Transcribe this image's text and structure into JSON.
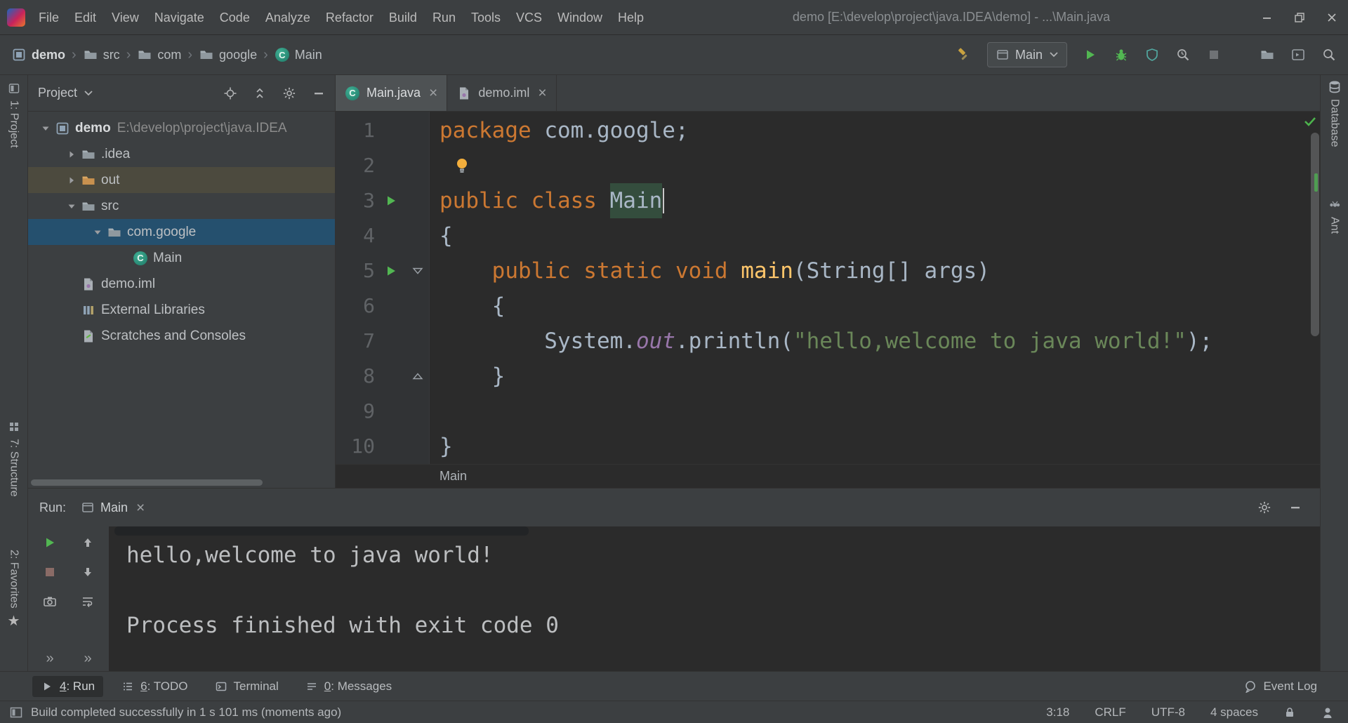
{
  "titlebar": {
    "menus": [
      "File",
      "Edit",
      "View",
      "Navigate",
      "Code",
      "Analyze",
      "Refactor",
      "Build",
      "Run",
      "Tools",
      "VCS",
      "Window",
      "Help"
    ],
    "title": "demo [E:\\develop\\project\\java.IDEA\\demo] - ...\\Main.java"
  },
  "navbar": {
    "breadcrumbs": [
      {
        "label": "demo",
        "icon": "module",
        "bold": true
      },
      {
        "label": "src",
        "icon": "folder"
      },
      {
        "label": "com",
        "icon": "folder"
      },
      {
        "label": "google",
        "icon": "folder"
      },
      {
        "label": "Main",
        "icon": "class"
      }
    ],
    "run_config": "Main"
  },
  "stripes": {
    "left": [
      {
        "label": "1: Project"
      },
      {
        "label": "7: Structure"
      },
      {
        "label": "2: Favorites"
      }
    ],
    "right": [
      {
        "label": "Database"
      },
      {
        "label": "Ant"
      }
    ]
  },
  "project": {
    "header": "Project",
    "tree": [
      {
        "depth": 0,
        "expand": "down",
        "icon": "module",
        "label": "demo",
        "path": "E:\\develop\\project\\java.IDEA",
        "bold": true
      },
      {
        "depth": 1,
        "expand": "right",
        "icon": "folder",
        "label": ".idea"
      },
      {
        "depth": 1,
        "expand": "right",
        "icon": "folder-out",
        "label": "out",
        "highlight": true
      },
      {
        "depth": 1,
        "expand": "down",
        "icon": "folder",
        "label": "src"
      },
      {
        "depth": 2,
        "expand": "down",
        "icon": "folder",
        "label": "com.google",
        "selected": true
      },
      {
        "depth": 3,
        "icon": "class",
        "label": "Main"
      },
      {
        "depth": 1,
        "icon": "iml",
        "label": "demo.iml"
      },
      {
        "depth": 1,
        "icon": "libs",
        "label": "External Libraries"
      },
      {
        "depth": 1,
        "icon": "scratches",
        "label": "Scratches and Consoles"
      }
    ]
  },
  "editor": {
    "tabs": [
      {
        "label": "Main.java",
        "icon": "class",
        "active": true
      },
      {
        "label": "demo.iml",
        "icon": "iml",
        "active": false
      }
    ],
    "breadcrumb": "Main",
    "lines": [
      {
        "num": 1,
        "segments": [
          {
            "t": "package ",
            "s": "kw"
          },
          {
            "t": "com.google;",
            "s": "pln"
          }
        ]
      },
      {
        "num": 2,
        "bulb": true,
        "segments": []
      },
      {
        "num": 3,
        "run": true,
        "caret": true,
        "segments": [
          {
            "t": "public class ",
            "s": "kw"
          },
          {
            "t": "Main",
            "s": "ident"
          }
        ]
      },
      {
        "num": 4,
        "segments": [
          {
            "t": "{",
            "s": "pln"
          }
        ]
      },
      {
        "num": 5,
        "run": true,
        "fold": "down",
        "segments": [
          {
            "t": "    ",
            "s": "pln"
          },
          {
            "t": "public static void ",
            "s": "kw"
          },
          {
            "t": "main",
            "s": "mth"
          },
          {
            "t": "(String[] args)",
            "s": "pln"
          }
        ]
      },
      {
        "num": 6,
        "segments": [
          {
            "t": "    {",
            "s": "pln"
          }
        ]
      },
      {
        "num": 7,
        "segments": [
          {
            "t": "        System.",
            "s": "pln"
          },
          {
            "t": "out",
            "s": "fld"
          },
          {
            "t": ".println(",
            "s": "pln"
          },
          {
            "t": "\"hello,welcome to java world!\"",
            "s": "str"
          },
          {
            "t": ");",
            "s": "pln"
          }
        ]
      },
      {
        "num": 8,
        "fold": "up",
        "segments": [
          {
            "t": "    }",
            "s": "pln"
          }
        ]
      },
      {
        "num": 9,
        "segments": []
      },
      {
        "num": 10,
        "segments": [
          {
            "t": "}",
            "s": "pln"
          }
        ]
      }
    ]
  },
  "run": {
    "label": "Run:",
    "tab": "Main",
    "console": [
      "hello,welcome to java world!",
      "",
      "Process finished with exit code 0"
    ]
  },
  "bottombar": {
    "items": [
      {
        "icon": "run-small",
        "mnemonic": "4",
        "rest": ": Run",
        "active": true
      },
      {
        "icon": "todo",
        "mnemonic": "6",
        "rest": ": TODO",
        "active": false
      },
      {
        "icon": "terminal",
        "mnemonic": "",
        "rest": "Terminal",
        "active": false
      },
      {
        "icon": "messages",
        "mnemonic": "0",
        "rest": ": Messages",
        "active": false
      }
    ],
    "event_log": "Event Log"
  },
  "statusbar": {
    "message": "Build completed successfully in 1 s 101 ms (moments ago)",
    "right": [
      "3:18",
      "CRLF",
      "UTF-8",
      "4 spaces"
    ]
  },
  "colors": {
    "panel_bg": "#3c3f41",
    "editor_bg": "#2b2b2b",
    "keyword": "#cc7832",
    "method": "#ffc66b",
    "string": "#6a8759",
    "field": "#9876aa",
    "selection": "#25506e",
    "run_green": "#52b752"
  }
}
